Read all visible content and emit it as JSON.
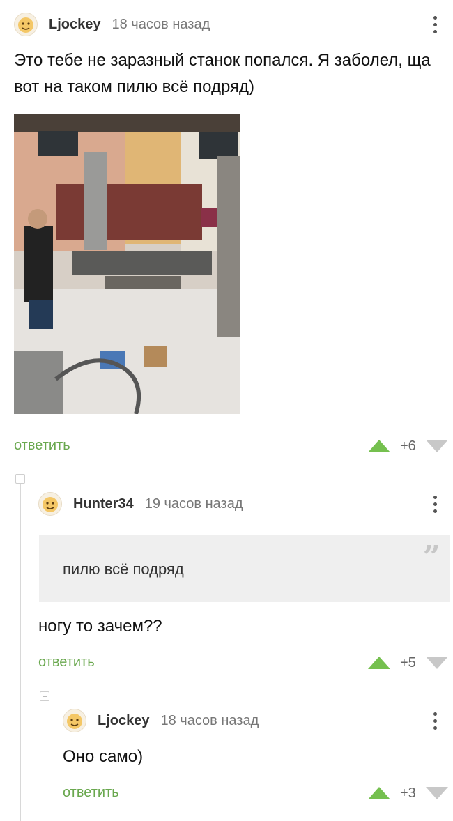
{
  "comments": [
    {
      "username": "Ljockey",
      "time": "18 часов назад",
      "text": "Это тебе не заразный станок попался. Я заболел, ща вот на таком пилю всё подряд)",
      "reply": "ответить",
      "score": "+6"
    },
    {
      "username": "Hunter34",
      "time": "19 часов назад",
      "quote": "пилю всё подряд",
      "text": "ногу то зачем??",
      "reply": "ответить",
      "score": "+5"
    },
    {
      "username": "Ljockey",
      "time": "18 часов назад",
      "text": "Оно само)",
      "reply": "ответить",
      "score": "+3"
    }
  ],
  "colors": {
    "reply_link": "#6aa84f",
    "vote_up": "#75c04f",
    "vote_down": "#c8c8c8",
    "quote_bg": "#efefef"
  },
  "icons": {
    "avatar": "avatar-face-icon",
    "more": "more-vertical-icon",
    "upvote": "arrow-up-icon",
    "downvote": "arrow-down-icon",
    "quote": "quote-icon",
    "collapse": "collapse-minus-icon"
  }
}
